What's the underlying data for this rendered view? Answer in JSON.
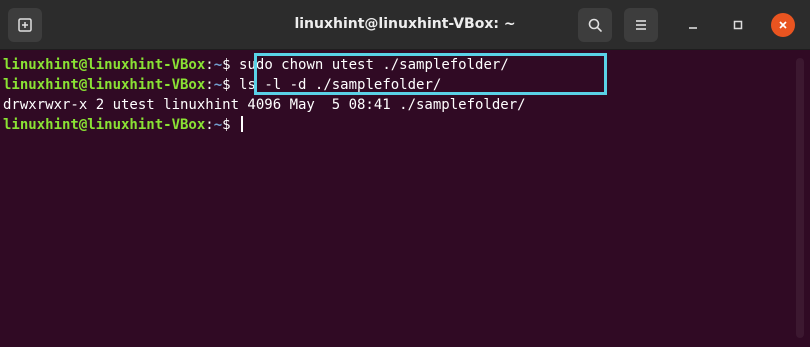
{
  "window": {
    "title": "linuxhint@linuxhint-VBox: ~"
  },
  "icons": {
    "new_tab": "new-tab-icon",
    "search": "search-icon",
    "menu": "hamburger-menu-icon",
    "minimize": "minimize-icon",
    "maximize": "maximize-icon",
    "close": "close-icon"
  },
  "terminal": {
    "prompt_user": "linuxhint@linuxhint-VBox",
    "prompt_path": "~",
    "prompt_symbol": "$",
    "lines": [
      {
        "type": "command",
        "command": " sudo chown utest ./samplefolder/"
      },
      {
        "type": "command",
        "command": " ls -l -d ./samplefolder/"
      },
      {
        "type": "output",
        "text": "drwxrwxr-x 2 utest linuxhint 4096 May  5 08:41 ./samplefolder/"
      },
      {
        "type": "command",
        "command": " "
      }
    ]
  },
  "colors": {
    "terminal_background": "#300a24",
    "prompt_user": "#8ae234",
    "prompt_path": "#729fcf",
    "highlight_box": "#5ad1e6",
    "close_button": "#e95420"
  }
}
